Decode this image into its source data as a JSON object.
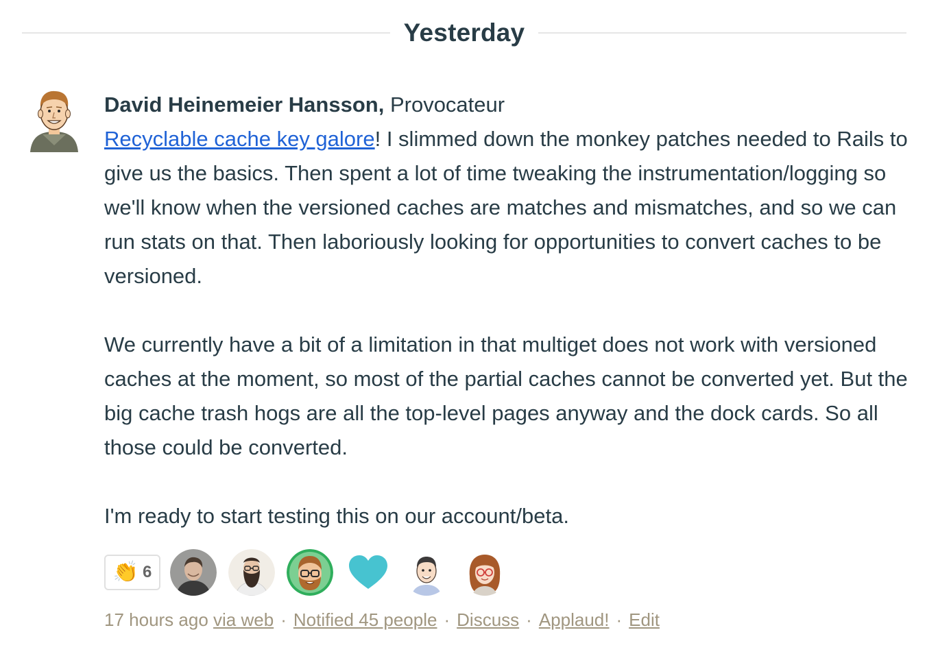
{
  "divider": {
    "label": "Yesterday"
  },
  "post": {
    "author": "David Heinemeier Hansson,",
    "role": "Provocateur",
    "link_text": "Recyclable cache key galore",
    "paragraph1_rest": "! I slimmed down the monkey patches needed to Rails to give us the basics. Then spent a lot of time tweaking the instrumentation/logging so we'll know when the versioned caches are matches and mismatches, and so we can run stats on that. Then laboriously looking for opportunities to convert caches to be versioned.",
    "paragraph2": "We currently have a bit of a limitation in that multiget does not work with versioned caches at the moment, so most of the partial caches cannot be converted yet. But the big cache trash hogs are all the top-level pages anyway and the dock cards. So all those could be converted.",
    "paragraph3": "I'm ready to start testing this on our account/beta."
  },
  "applause": {
    "icon": "clapping-hands-icon",
    "glyph": "👏",
    "count": "6"
  },
  "boosters": [
    {
      "name": "booster-avatar-1",
      "icon": "person-photo-avatar"
    },
    {
      "name": "booster-avatar-2",
      "icon": "bearded-man-avatar"
    },
    {
      "name": "booster-avatar-3",
      "icon": "glasses-man-green-avatar"
    },
    {
      "name": "booster-avatar-4",
      "icon": "heart-icon",
      "color": "#47c3d0"
    },
    {
      "name": "booster-avatar-5",
      "icon": "cartoon-man-avatar"
    },
    {
      "name": "booster-avatar-6",
      "icon": "cartoon-woman-avatar"
    }
  ],
  "meta": {
    "time": "17 hours ago",
    "via": "via web",
    "sep": "·",
    "notified": "Notified 45 people",
    "discuss": "Discuss",
    "applaud": "Applaud!",
    "edit": "Edit"
  },
  "colors": {
    "text": "#283c46",
    "link": "#1f62d6",
    "meta": "#a09680",
    "divider": "#e6e6e6",
    "heart": "#47c3d0"
  }
}
